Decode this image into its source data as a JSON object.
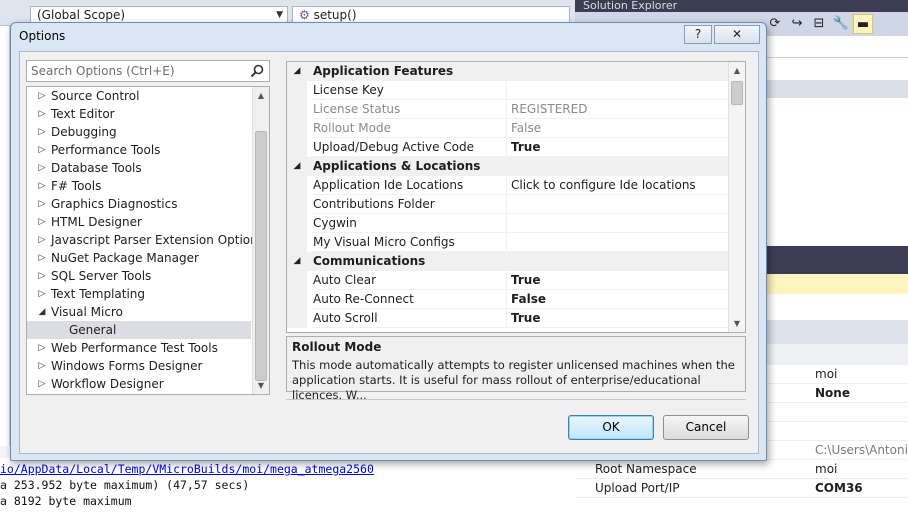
{
  "ide": {
    "scope_combo": "(Global Scope)",
    "member_combo": "setup()",
    "solution_explorer_title": "Solution Explorer",
    "output_lines": [
      "io/AppData/Local/Temp/VMicroBuilds/moi/mega_atmega2560",
      "a 253.952 byte maximum) (47,57 secs)",
      "a 8192 byte maximum"
    ],
    "properties": [
      {
        "name": "",
        "value": "moi",
        "style": "normal"
      },
      {
        "name": "",
        "value": "None",
        "style": "bold"
      },
      {
        "name": "",
        "value": "",
        "style": "normal"
      },
      {
        "name": "",
        "value": "",
        "style": "normal"
      },
      {
        "name": "",
        "value": "C:\\Users\\Antonio",
        "style": "gray"
      },
      {
        "name": "Root Namespace",
        "value": "moi",
        "style": "normal"
      },
      {
        "name": "Upload Port/IP",
        "value": "COM36",
        "style": "bold"
      }
    ]
  },
  "dialog": {
    "title": "Options",
    "help_label": "?",
    "close_label": "✕",
    "search_placeholder": "Search Options (Ctrl+E)",
    "tree": [
      {
        "label": "Source Control",
        "expanded": false,
        "child": false,
        "selected": false
      },
      {
        "label": "Text Editor",
        "expanded": false,
        "child": false,
        "selected": false
      },
      {
        "label": "Debugging",
        "expanded": false,
        "child": false,
        "selected": false
      },
      {
        "label": "Performance Tools",
        "expanded": false,
        "child": false,
        "selected": false
      },
      {
        "label": "Database Tools",
        "expanded": false,
        "child": false,
        "selected": false
      },
      {
        "label": "F# Tools",
        "expanded": false,
        "child": false,
        "selected": false
      },
      {
        "label": "Graphics Diagnostics",
        "expanded": false,
        "child": false,
        "selected": false
      },
      {
        "label": "HTML Designer",
        "expanded": false,
        "child": false,
        "selected": false
      },
      {
        "label": "Javascript Parser Extension Options",
        "expanded": false,
        "child": false,
        "selected": false
      },
      {
        "label": "NuGet Package Manager",
        "expanded": false,
        "child": false,
        "selected": false
      },
      {
        "label": "SQL Server Tools",
        "expanded": false,
        "child": false,
        "selected": false
      },
      {
        "label": "Text Templating",
        "expanded": false,
        "child": false,
        "selected": false
      },
      {
        "label": "Visual Micro",
        "expanded": true,
        "child": false,
        "selected": false
      },
      {
        "label": "General",
        "expanded": false,
        "child": true,
        "selected": true
      },
      {
        "label": "Web Performance Test Tools",
        "expanded": false,
        "child": false,
        "selected": false
      },
      {
        "label": "Windows Forms Designer",
        "expanded": false,
        "child": false,
        "selected": false
      },
      {
        "label": "Workflow Designer",
        "expanded": false,
        "child": false,
        "selected": false
      }
    ],
    "grid": [
      {
        "type": "category",
        "name": "Application Features",
        "value": ""
      },
      {
        "type": "prop",
        "name": "License Key",
        "value": "",
        "disabled": false,
        "bold": false
      },
      {
        "type": "prop",
        "name": "License Status",
        "value": "REGISTERED",
        "disabled": true,
        "bold": false
      },
      {
        "type": "prop",
        "name": "Rollout Mode",
        "value": "False",
        "disabled": true,
        "bold": false
      },
      {
        "type": "prop",
        "name": "Upload/Debug Active Code",
        "value": "True",
        "disabled": false,
        "bold": true
      },
      {
        "type": "category",
        "name": "Applications & Locations",
        "value": ""
      },
      {
        "type": "prop",
        "name": "Application Ide Locations",
        "value": "Click to configure Ide locations",
        "disabled": false,
        "bold": false
      },
      {
        "type": "prop",
        "name": "Contributions Folder",
        "value": "",
        "disabled": false,
        "bold": false
      },
      {
        "type": "prop",
        "name": "Cygwin",
        "value": "",
        "disabled": false,
        "bold": false
      },
      {
        "type": "prop",
        "name": "My Visual Micro Configs",
        "value": "",
        "disabled": false,
        "bold": false
      },
      {
        "type": "category",
        "name": "Communications",
        "value": ""
      },
      {
        "type": "prop",
        "name": "Auto Clear",
        "value": "True",
        "disabled": false,
        "bold": true
      },
      {
        "type": "prop",
        "name": "Auto Re-Connect",
        "value": "False",
        "disabled": false,
        "bold": true
      },
      {
        "type": "prop",
        "name": "Auto Scroll",
        "value": "True",
        "disabled": false,
        "bold": true
      }
    ],
    "description": {
      "title": "Rollout Mode",
      "text": "This mode automatically attempts to register unlicensed machines when the application starts. It is useful for mass rollout of enterprise/educational licences. W..."
    },
    "ok_label": "OK",
    "cancel_label": "Cancel"
  },
  "colors": {
    "dialog_frame": "#dbe6f4",
    "selected_item": "#dcdde3",
    "ide_dark_band": "#3c3c54",
    "ide_highlight_band": "#fdf4bf"
  }
}
